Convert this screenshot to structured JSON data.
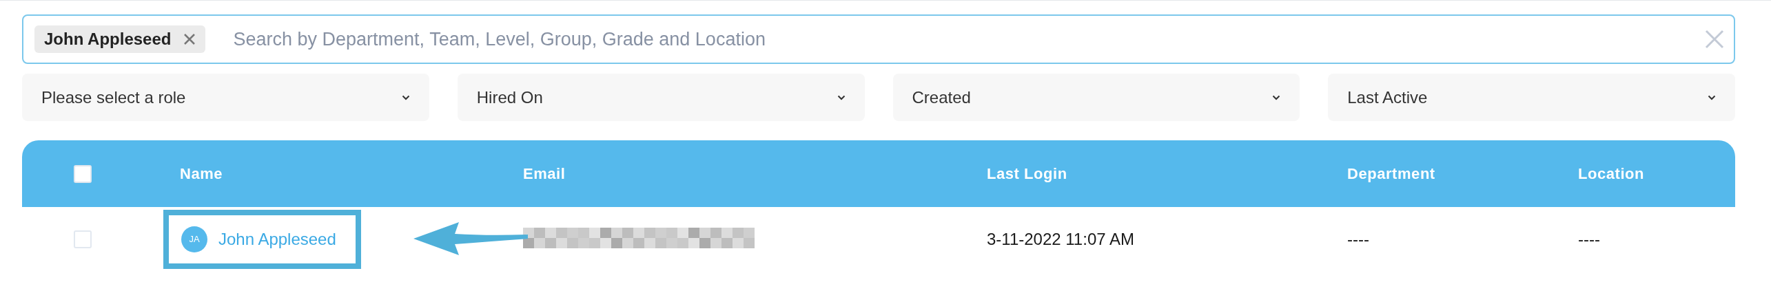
{
  "search": {
    "tags": [
      {
        "label": "John Appleseed"
      }
    ],
    "placeholder": "Search by Department, Team, Level, Group, Grade and Location"
  },
  "filters": [
    {
      "label": "Please select a role"
    },
    {
      "label": "Hired On"
    },
    {
      "label": "Created"
    },
    {
      "label": "Last Active"
    }
  ],
  "table": {
    "select_all": {
      "checked": false
    },
    "columns": [
      "Name",
      "Email",
      "Last Login",
      "Department",
      "Location"
    ],
    "rows": [
      {
        "selected": false,
        "initials": "JA",
        "name": "John Appleseed",
        "highlighted": true,
        "email_blurred": true,
        "last_login": "3-11-2022 11:07 AM",
        "department": "----",
        "location": "----"
      }
    ]
  }
}
